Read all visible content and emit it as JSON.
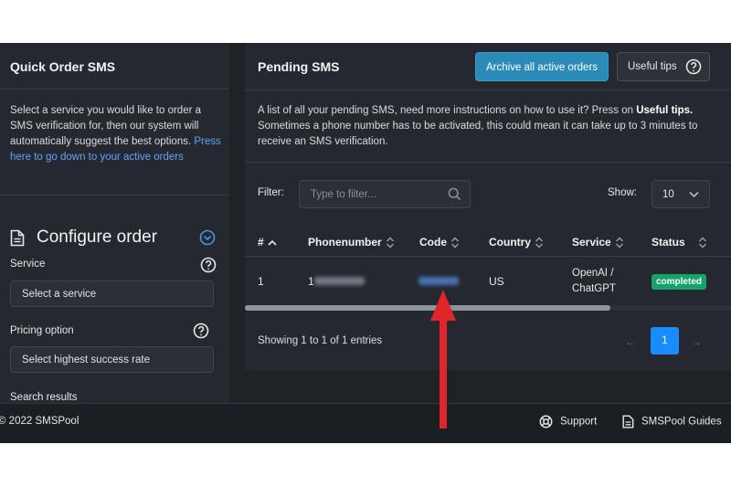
{
  "left_panel": {
    "title": "Quick Order SMS",
    "description": "Select a service you would like to order a SMS verification for, then our system will automatically suggest the best options.",
    "link_text": "Press here to go down to your active orders",
    "configure_title": "Configure order",
    "service_label": "Service",
    "service_placeholder": "Select a service",
    "pricing_label": "Pricing option",
    "pricing_value": "Select highest success rate",
    "search_results_label": "Search results"
  },
  "right_panel": {
    "title": "Pending SMS",
    "archive_button": "Archive all active orders",
    "tips_button": "Useful tips",
    "description_main": "A list of all your pending SMS, need more instructions on how to use it? Press on ",
    "description_bold": "Useful tips.",
    "description_tail": " Sometimes a phone number has to be activated, this could mean it can take up to 3 minutes to receive an SMS verification.",
    "filter_label": "Filter:",
    "filter_placeholder": "Type to filter...",
    "show_label": "Show:",
    "show_value": "10",
    "columns": [
      "#",
      "Phonenumber",
      "Code",
      "Country",
      "Service",
      "Status"
    ],
    "rows": [
      {
        "index": "1",
        "phone_prefix": "1",
        "country": "US",
        "service_line1": "OpenAI /",
        "service_line2": "ChatGPT",
        "status": "completed"
      }
    ],
    "showing_text": "Showing 1 to 1 of 1 entries",
    "pagination": {
      "prev": "←",
      "current": "1",
      "next": "→"
    }
  },
  "footer": {
    "copyright": "© 2022 SMSPool",
    "support": "Support",
    "guides": "SMSPool Guides"
  },
  "colors": {
    "archive_button": "#2a8bb8",
    "status_completed": "#16a26a",
    "page_active": "#1a8cff",
    "link": "#5ea2ff",
    "annotation_arrow": "#e0262b"
  },
  "icons": {
    "configure": "document-icon",
    "configure_toggle": "chevron-down-circle-icon",
    "help": "question-circle-icon",
    "filter": "search-icon",
    "show": "chevron-down-icon",
    "sort": "sort-icon",
    "support": "lifebuoy-icon",
    "guides": "document-icon"
  }
}
